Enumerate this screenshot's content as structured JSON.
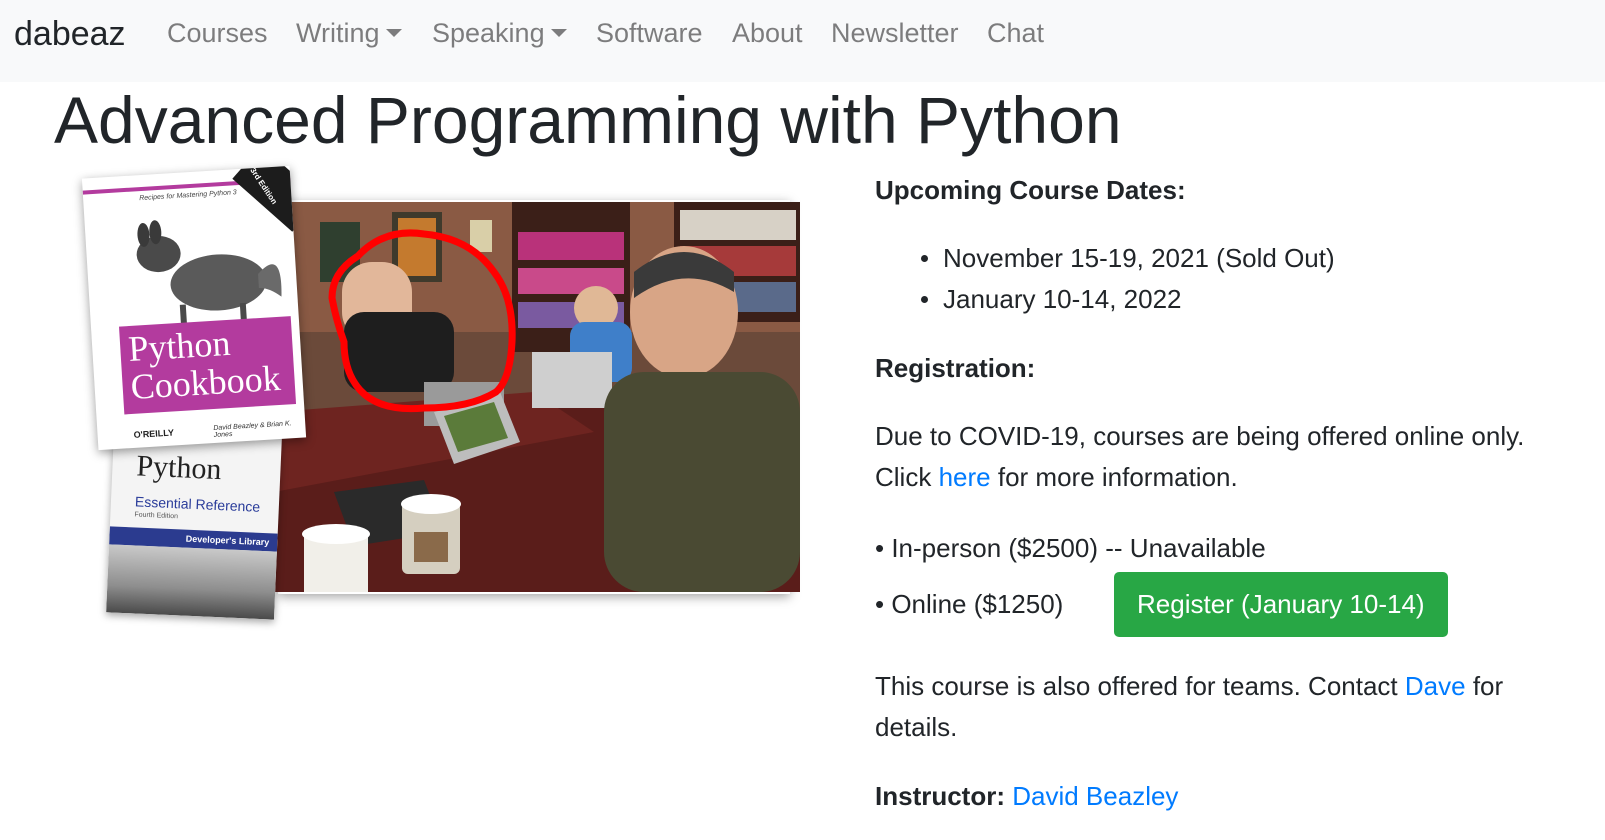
{
  "navbar": {
    "brand": "dabeaz",
    "items": [
      {
        "label": "Courses",
        "dropdown": false
      },
      {
        "label": "Writing",
        "dropdown": true
      },
      {
        "label": "Speaking",
        "dropdown": true
      },
      {
        "label": "Software",
        "dropdown": false
      },
      {
        "label": "About",
        "dropdown": false
      },
      {
        "label": "Newsletter",
        "dropdown": false
      },
      {
        "label": "Chat",
        "dropdown": false
      }
    ]
  },
  "page": {
    "title": "Advanced Programming with Python"
  },
  "hero": {
    "cookbook": {
      "tagline": "Recipes for Mastering Python 3",
      "edition": "3rd Edition",
      "title_line1": "Python",
      "title_line2": "Cookbook",
      "publisher": "O'REILLY",
      "authors": "David Beazley & Brian K. Jones"
    },
    "essential_reference": {
      "title": "Python",
      "subtitle": "Essential Reference",
      "edition": "Fourth Edition",
      "series": "Developer's Library"
    }
  },
  "course": {
    "dates_heading": "Upcoming Course Dates:",
    "dates": [
      "November 15-19, 2021 (Sold Out)",
      "January 10-14, 2022"
    ],
    "registration_heading": "Registration:",
    "covid_text": "Due to COVID-19, courses are being offered online only.",
    "click_prefix": "Click",
    "here_link": "here",
    "click_suffix": "for more information.",
    "in_person_label": "• In-person ($2500)",
    "in_person_status": "-- Unavailable",
    "online_label": "• Online ($1250)",
    "register_button": "Register (January 10-14)",
    "teams_text": "This course is also offered for teams. Contact",
    "dave_link": "Dave",
    "teams_suffix": "for",
    "details": "details.",
    "instructor_label": "Instructor:",
    "instructor_link": "David Beazley"
  },
  "colors": {
    "link": "#007bff",
    "register_button": "#28a745",
    "navbar_bg": "#f8f9fa",
    "cookbook_accent": "#b33b9e",
    "highlight_circle": "#ff0000"
  }
}
